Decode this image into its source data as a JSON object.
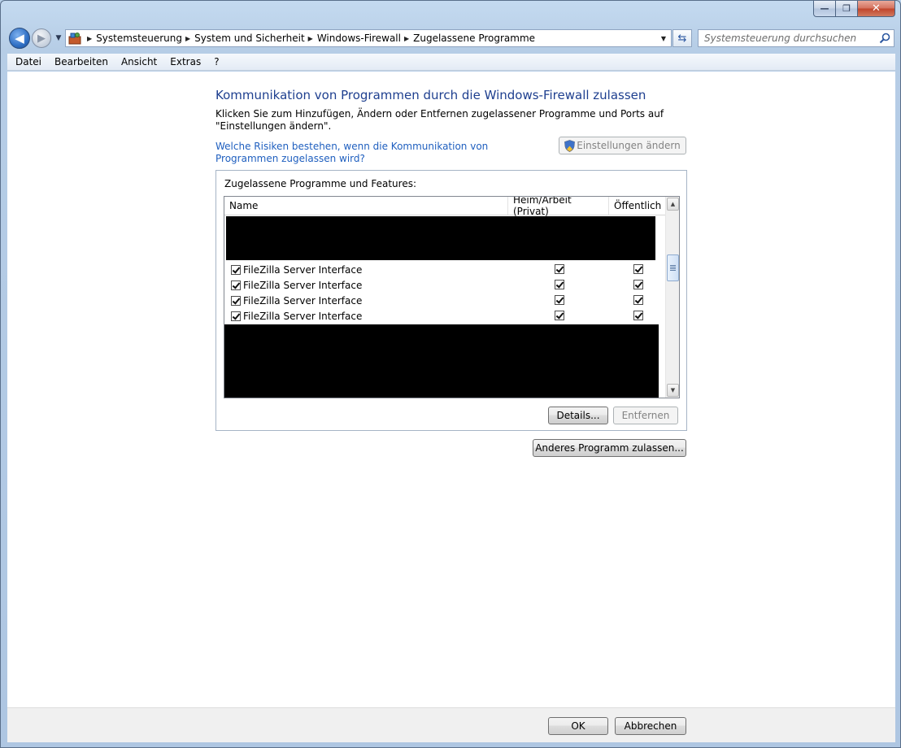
{
  "window": {
    "minimize_symbol": "—",
    "maximize_symbol": "❐",
    "close_symbol": "✕"
  },
  "navigation": {
    "back_glyph": "◀",
    "forward_glyph": "▶",
    "recent_glyph": "▼",
    "breadcrumbs": [
      "Systemsteuerung",
      "System und Sicherheit",
      "Windows-Firewall",
      "Zugelassene Programme"
    ],
    "search_placeholder": "Systemsteuerung durchsuchen"
  },
  "menu": [
    "Datei",
    "Bearbeiten",
    "Ansicht",
    "Extras",
    "?"
  ],
  "page": {
    "title": "Kommunikation von Programmen durch die Windows-Firewall zulassen",
    "instructions": "Klicken Sie zum Hinzufügen, Ändern oder Entfernen zugelassener Programme und Ports auf \"Einstellungen ändern\".",
    "risk_link": "Welche Risiken bestehen, wenn die Kommunikation von Programmen zugelassen wird?",
    "change_settings_button": "Einstellungen ändern"
  },
  "programs": {
    "group_label": "Zugelassene Programme und Features:",
    "columns": {
      "name": "Name",
      "home": "Heim/Arbeit (Privat)",
      "public": "Öffentlich"
    },
    "rows": [
      {
        "name": "FileZilla Server Interface",
        "enabled": true,
        "home": true,
        "public": true
      },
      {
        "name": "FileZilla Server Interface",
        "enabled": true,
        "home": true,
        "public": true
      },
      {
        "name": "FileZilla Server Interface",
        "enabled": true,
        "home": true,
        "public": true
      },
      {
        "name": "FileZilla Server Interface",
        "enabled": true,
        "home": true,
        "public": true
      }
    ],
    "details_button": "Details...",
    "remove_button": "Entfernen",
    "add_program_button": "Anderes Programm zulassen..."
  },
  "footer": {
    "ok_button": "OK",
    "cancel_button": "Abbrechen"
  },
  "colors": {
    "title_blue": "#1e3f8f",
    "link_blue": "#1f5fbf",
    "redaction": "#000000"
  }
}
